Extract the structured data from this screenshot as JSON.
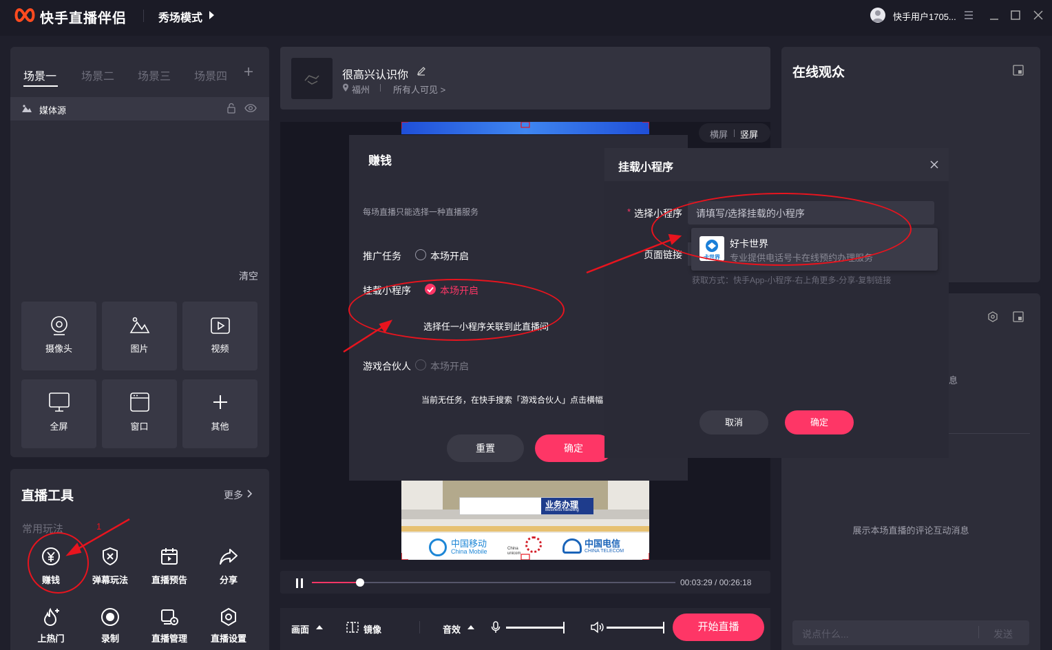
{
  "titlebar": {
    "app_name": "快手直播伴侣",
    "mode": "秀场模式",
    "username": "快手用户1705..."
  },
  "scenes": {
    "tabs": [
      "场景一",
      "场景二",
      "场景三",
      "场景四"
    ],
    "active_tab": "场景一",
    "source_name": "媒体源",
    "clear_label": "清空"
  },
  "sources": [
    {
      "label": "摄像头",
      "icon": "camera-icon"
    },
    {
      "label": "图片",
      "icon": "image-icon"
    },
    {
      "label": "视频",
      "icon": "video-icon"
    },
    {
      "label": "全屏",
      "icon": "monitor-icon"
    },
    {
      "label": "窗口",
      "icon": "window-icon"
    },
    {
      "label": "其他",
      "icon": "plus-icon"
    }
  ],
  "tools": {
    "title": "直播工具",
    "more": "更多",
    "section": "常用玩法",
    "items": [
      {
        "label": "赚钱",
        "icon": "yen-icon"
      },
      {
        "label": "弹幕玩法",
        "icon": "shield-x-icon"
      },
      {
        "label": "直播预告",
        "icon": "calendar-icon"
      },
      {
        "label": "分享",
        "icon": "share-icon"
      },
      {
        "label": "上热门",
        "icon": "fire-icon"
      },
      {
        "label": "录制",
        "icon": "record-icon"
      },
      {
        "label": "直播管理",
        "icon": "manage-icon"
      },
      {
        "label": "直播设置",
        "icon": "settings-icon"
      }
    ]
  },
  "stream": {
    "title": "很高兴认识你",
    "location": "福州",
    "visibility": "所有人可见 >",
    "orientation": {
      "landscape": "横屏",
      "portrait": "竖屏"
    }
  },
  "preview_text": {
    "business": "业务办理",
    "business_en": "Business handling",
    "cm_cn": "中国移动",
    "cm_en": "China Mobile",
    "cu_en": "China unicom",
    "ct_cn": "中国电信",
    "ct_en": "CHINA TELECOM"
  },
  "playback": {
    "current": "00:03:29",
    "total": "00:26:18",
    "progress_fraction": 0.133
  },
  "bottom": {
    "canvas": "画面",
    "mirror": "镜像",
    "sound": "音效",
    "mic_level": 1.0,
    "speaker_level": 1.0,
    "start": "开始直播"
  },
  "audience": {
    "title": "在线观众"
  },
  "chat": {
    "partial_text": "息",
    "empty_text": "展示本场直播的评论互动消息",
    "placeholder": "说点什么...",
    "send": "发送"
  },
  "earn_modal": {
    "title": "赚钱",
    "note": "每场直播只能选择一种直播服务",
    "promo_label": "推广任务",
    "promo_option": "本场开启",
    "mini_label": "挂载小程序",
    "mini_option": "本场开启",
    "mini_hint": "选择任一小程序关联到此直播间",
    "game_label": "游戏合伙人",
    "game_option": "本场开启",
    "game_hint": "当前无任务，在快手搜索「游戏合伙人」点击横幅",
    "reset": "重置",
    "confirm": "确定"
  },
  "mini_modal": {
    "title": "挂载小程序",
    "select_label": "选择小程序",
    "required_mark": "*",
    "select_placeholder": "请填写/选择挂载的小程序",
    "link_label": "页面链接",
    "option_name": "好卡世界",
    "option_desc": "专业提供电话号卡在线预约办理服务",
    "option_logo_text": "卡世界",
    "hint": "获取方式：快手App-小程序-右上角更多-分享-复制链接",
    "cancel": "取消",
    "confirm": "确定"
  },
  "annotation": {
    "mark": "1"
  },
  "colors": {
    "accent": "#fe3666",
    "annotation_red": "#e8141e",
    "panel": "#2d2d39",
    "background": "#1f1f2b"
  }
}
